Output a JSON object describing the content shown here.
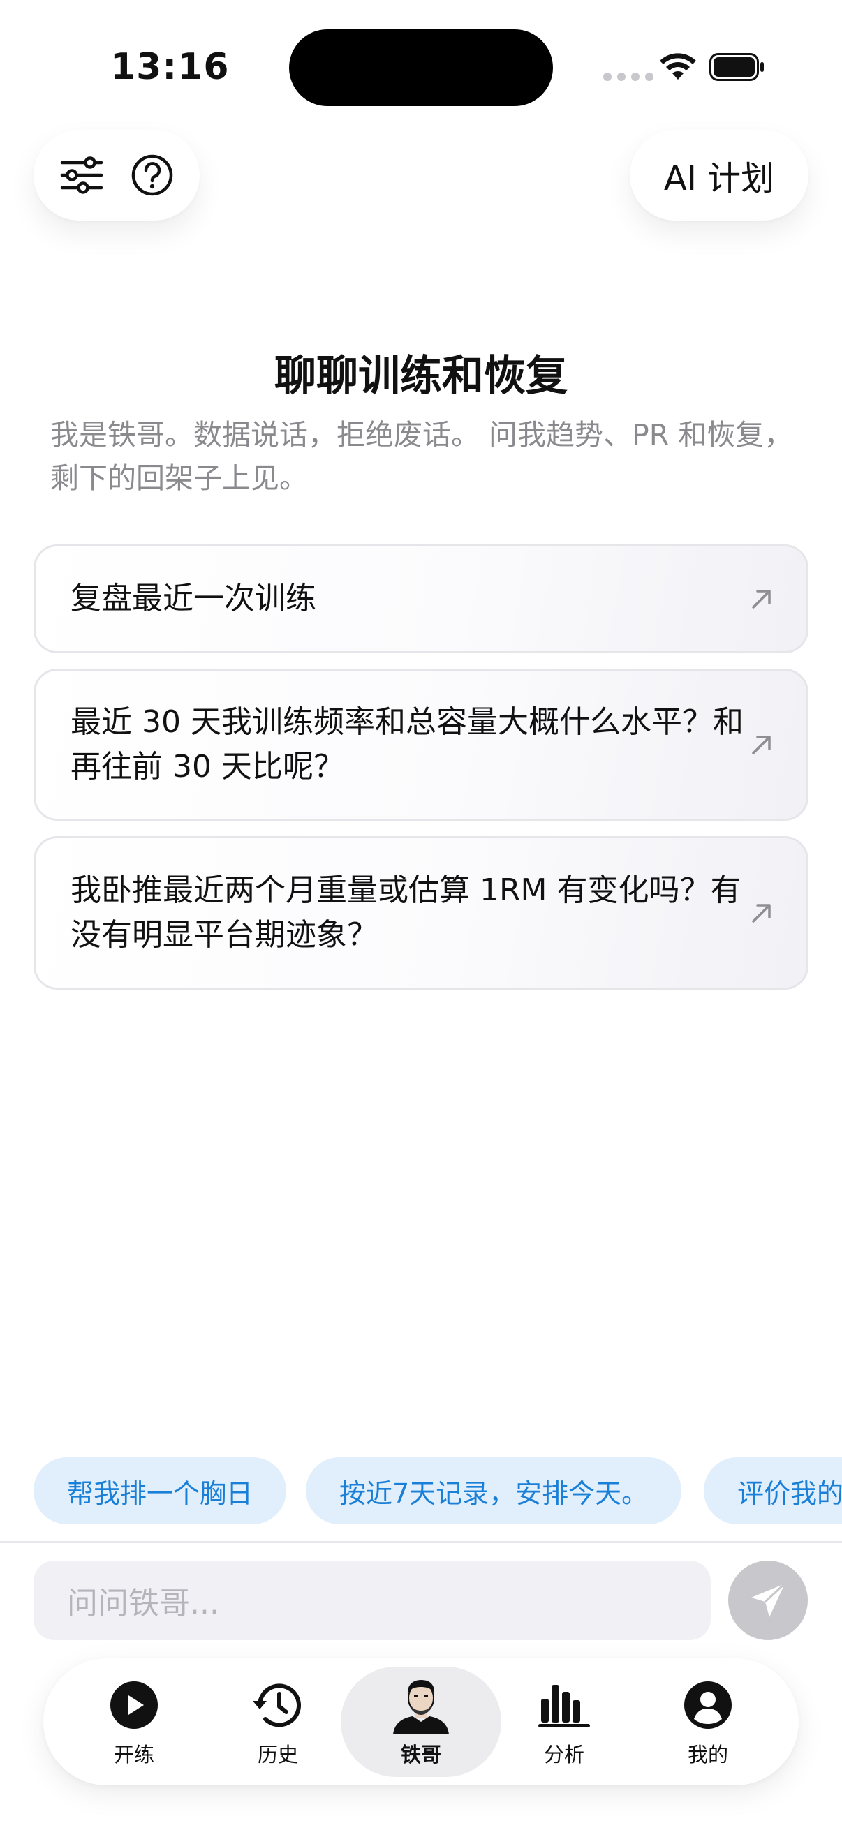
{
  "status_bar": {
    "time": "13:16"
  },
  "header": {
    "ai_plan_label": "AI 计划",
    "filter_icon": "sliders-icon",
    "help_icon": "question-circle-icon"
  },
  "intro": {
    "title": "聊聊训练和恢复",
    "subtitle": "我是铁哥。数据说话，拒绝废话。 问我趋势、PR 和恢复，剩下的回架子上见。"
  },
  "suggestions": [
    {
      "text": "复盘最近一次训练",
      "icon": "arrow-up-right-icon"
    },
    {
      "text": "最近 30 天我训练频率和总容量大概什么水平？和再往前 30 天比呢？",
      "icon": "arrow-up-right-icon"
    },
    {
      "text": "我卧推最近两个月重量或估算 1RM 有变化吗？有没有明显平台期迹象？",
      "icon": "arrow-up-right-icon"
    }
  ],
  "chips": [
    "帮我排一个胸日",
    "按近7天记录，安排今天。",
    "评价我的"
  ],
  "input": {
    "placeholder": "问问铁哥..."
  },
  "tabs": [
    {
      "label": "开练",
      "icon": "play-circle-icon"
    },
    {
      "label": "历史",
      "icon": "history-clock-icon"
    },
    {
      "label": "铁哥",
      "icon": "coach-avatar-icon",
      "active": true
    },
    {
      "label": "分析",
      "icon": "bar-chart-icon"
    },
    {
      "label": "我的",
      "icon": "profile-icon"
    }
  ],
  "colors": {
    "chip_bg": "#e1effd",
    "chip_text": "#1a7fd6",
    "send_disabled": "#c7c7cc",
    "accent_text": "#111111"
  }
}
